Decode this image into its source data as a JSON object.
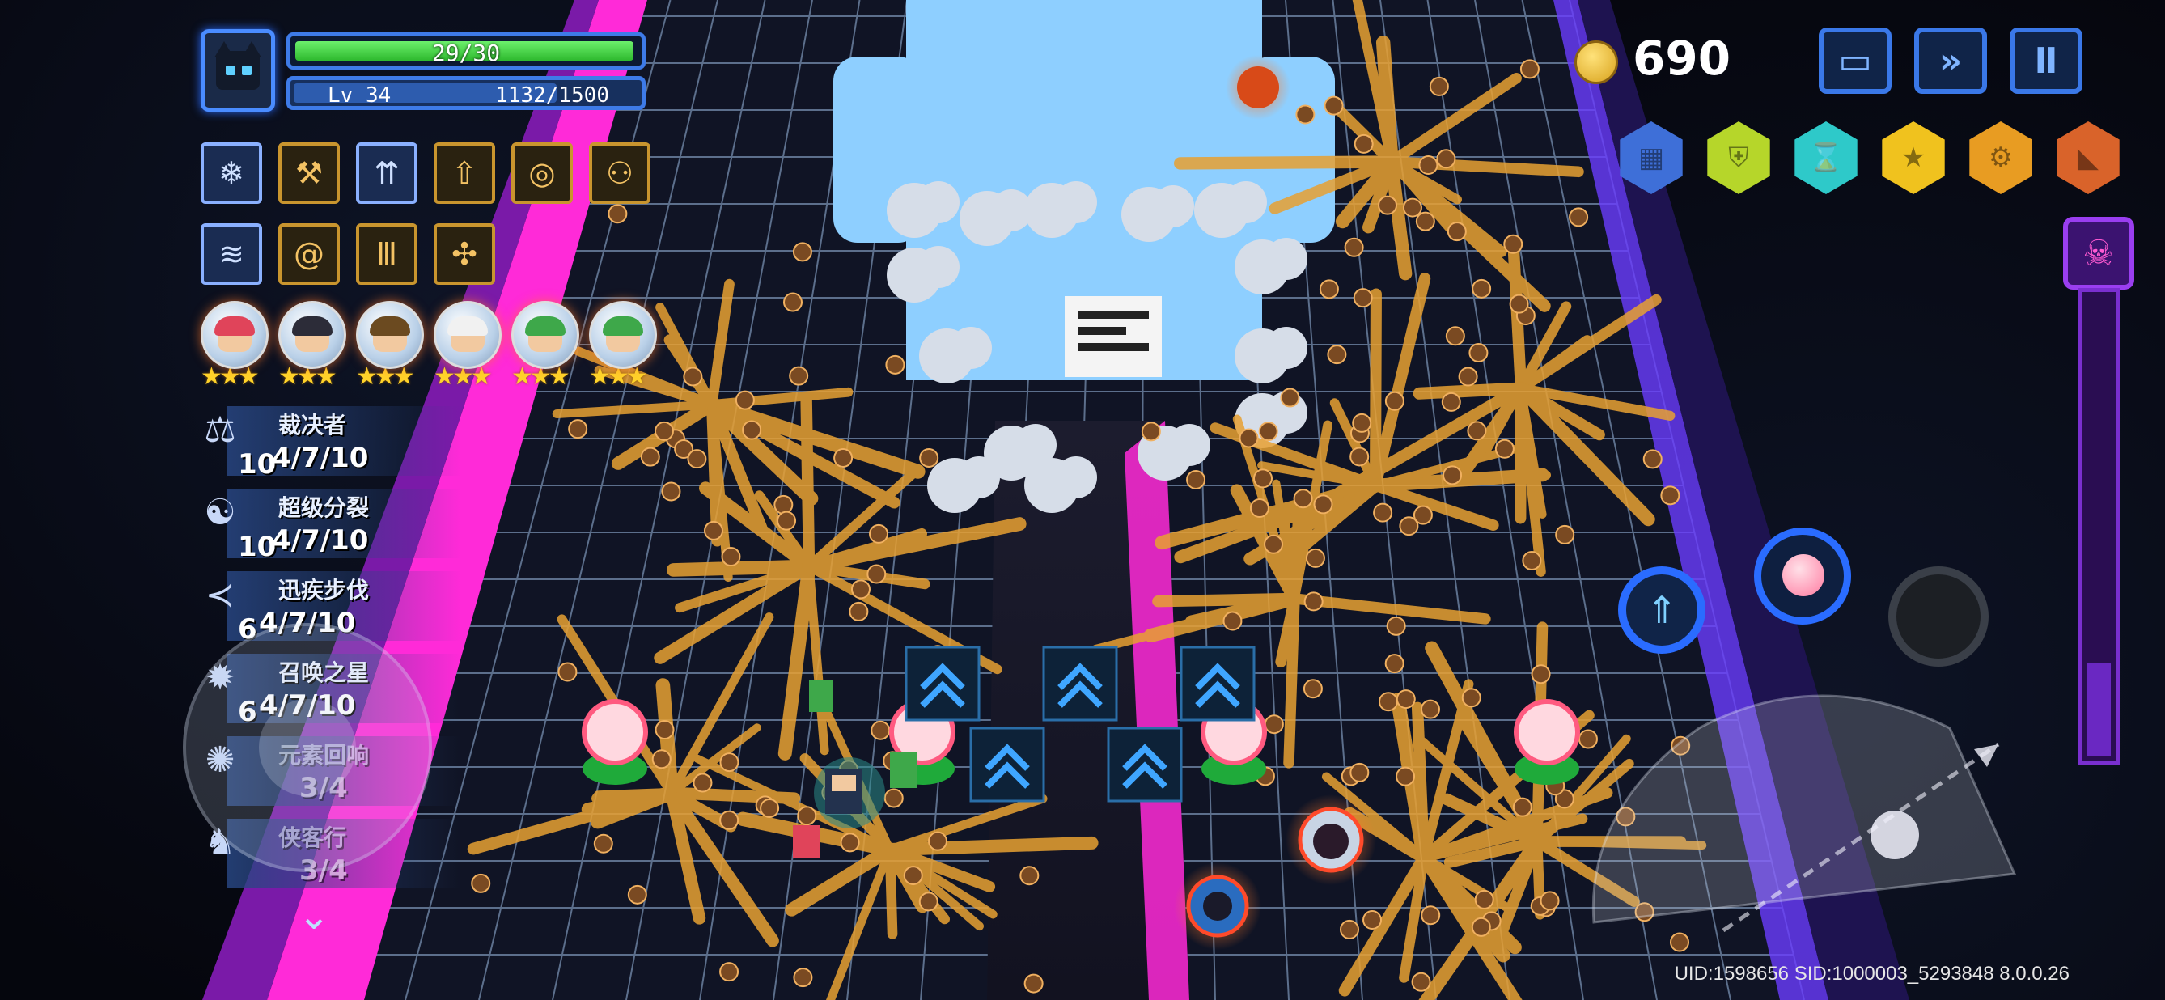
{
  "player": {
    "hp_text": "29/30",
    "hp_fraction": 0.967,
    "level_text": "Lv 34",
    "xp_text": "1132/1500",
    "xp_fraction": 0.755,
    "avatar_icon": "cat-avatar-icon"
  },
  "skills": [
    {
      "icon": "snowflake-icon",
      "glyph": "❄",
      "style": "blue"
    },
    {
      "icon": "hammer-icon",
      "glyph": "⚒",
      "style": "gold"
    },
    {
      "icon": "arrows-up-icon",
      "glyph": "⇈",
      "style": "blue"
    },
    {
      "icon": "arrow-up-box-icon",
      "glyph": "⇧",
      "style": "gold"
    },
    {
      "icon": "swirl-icon",
      "glyph": "◎",
      "style": "gold"
    },
    {
      "icon": "share-icon",
      "glyph": "⚇",
      "style": "gold"
    },
    {
      "icon": "wave-box-icon",
      "glyph": "≋",
      "style": "blue"
    },
    {
      "icon": "spiral-icon",
      "glyph": "@",
      "style": "gold"
    },
    {
      "icon": "pillar-icon",
      "glyph": "Ⅲ",
      "style": "gold"
    },
    {
      "icon": "molecule-icon",
      "glyph": "✣",
      "style": "gold"
    }
  ],
  "heroes": [
    {
      "hair": "#e0445a",
      "stars": "★★★"
    },
    {
      "hair": "#2c2c38",
      "stars": "★★★"
    },
    {
      "hair": "#6b4a20",
      "stars": "★★★"
    },
    {
      "hair": "#f1f1f1",
      "stars": "★★★"
    },
    {
      "hair": "#3ea84a",
      "stars": "★★★"
    },
    {
      "hair": "#3ea84a",
      "stars": "★★★"
    }
  ],
  "buffs": [
    {
      "name": "裁决者",
      "lead": "10",
      "progress": "4/7/10",
      "icon": "judge-hammer-icon",
      "glyph": "⚖",
      "dim": false
    },
    {
      "name": "超级分裂",
      "lead": "10",
      "progress": "4/7/10",
      "icon": "split-swirl-icon",
      "glyph": "☯",
      "dim": false
    },
    {
      "name": "迅疾步伐",
      "lead": "6",
      "progress": "4/7/10",
      "icon": "fast-step-icon",
      "glyph": "≺",
      "dim": false
    },
    {
      "name": "召唤之星",
      "lead": "6",
      "progress": "4/7/10",
      "icon": "summon-star-icon",
      "glyph": "✹",
      "dim": false
    },
    {
      "name": "元素回响",
      "lead": "",
      "progress": "3/4",
      "icon": "element-echo-icon",
      "glyph": "✺",
      "dim": true
    },
    {
      "name": "侠客行",
      "lead": "",
      "progress": "3/4",
      "icon": "wanderer-icon",
      "glyph": "♞",
      "dim": true
    }
  ],
  "coins": "690",
  "top_buttons": [
    {
      "icon": "folder-icon",
      "glyph": "▭"
    },
    {
      "icon": "fast-forward-icon",
      "glyph": "»"
    },
    {
      "icon": "pause-icon",
      "glyph": "Ⅱ"
    }
  ],
  "badges": [
    {
      "icon": "grid-badge-icon",
      "color": "#3e6fd8",
      "glyph": "▦"
    },
    {
      "icon": "shield-badge-icon",
      "color": "#b6d62a",
      "glyph": "⛨"
    },
    {
      "icon": "hourglass-badge-icon",
      "color": "#2ec9c9",
      "glyph": "⌛"
    },
    {
      "icon": "star-badge-icon",
      "color": "#f0c21e",
      "glyph": "★"
    },
    {
      "icon": "gear-badge-icon",
      "color": "#e89c22",
      "glyph": "⚙"
    },
    {
      "icon": "boot-badge-icon",
      "color": "#d9632a",
      "glyph": "◣"
    }
  ],
  "boss_gauge": {
    "fraction": 0.2,
    "icon": "skull-icon",
    "glyph": "☠"
  },
  "footer": {
    "uid_text": "UID:1598656 SID:1000003_5293848 8.0.0.26"
  },
  "colors": {
    "lane_magenta": "#ff2ad8",
    "grid_line": "#6f86a6",
    "boss_blue": "#8ecfff",
    "spike_orange": "#e8a132"
  }
}
